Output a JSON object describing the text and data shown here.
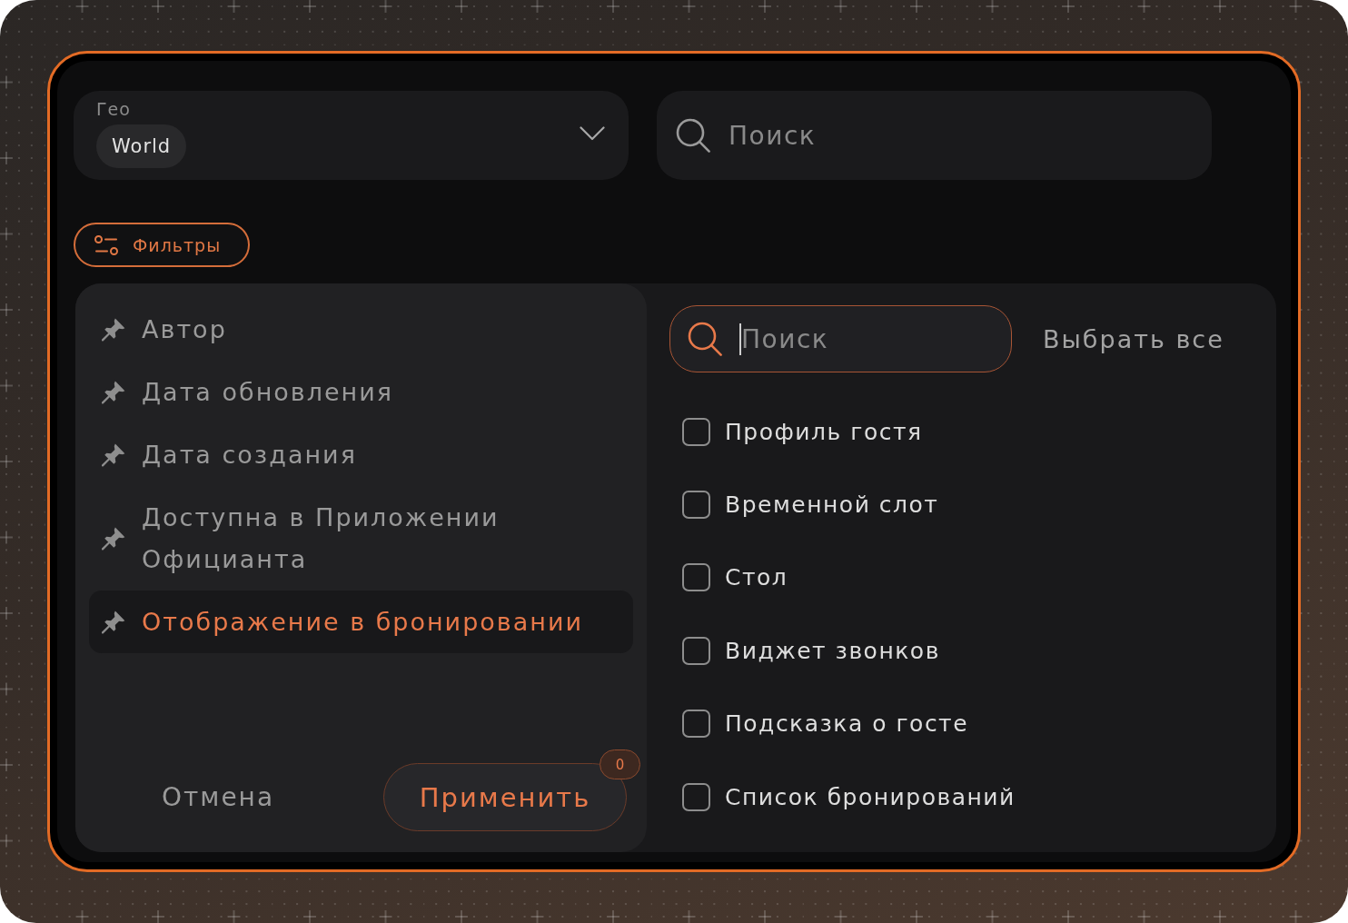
{
  "geo_select": {
    "label": "Гео",
    "tags": [
      "World"
    ]
  },
  "search": {
    "placeholder": "Поиск"
  },
  "filters_button": {
    "label": "Фильтры"
  },
  "filter_panel": {
    "fields": [
      {
        "label": "Автор",
        "selected": false
      },
      {
        "label": "Дата обновления",
        "selected": false
      },
      {
        "label": "Дата создания",
        "selected": false
      },
      {
        "label": "Доступна в Приложении Официанта",
        "selected": false
      },
      {
        "label": "Отображение в бронировании",
        "selected": true
      }
    ],
    "cancel_button": "Отмена",
    "apply_button": {
      "label": "Применить",
      "badge": "0"
    },
    "option_search": {
      "placeholder": "Поиск",
      "focused": true
    },
    "select_all": "Выбрать все",
    "options": [
      {
        "label": "Профиль гостя",
        "checked": false
      },
      {
        "label": "Временной слот",
        "checked": false
      },
      {
        "label": "Стол",
        "checked": false
      },
      {
        "label": "Виджет звонков",
        "checked": false
      },
      {
        "label": "Подсказка о госте",
        "checked": false
      },
      {
        "label": "Список бронирований",
        "checked": false
      }
    ]
  }
}
